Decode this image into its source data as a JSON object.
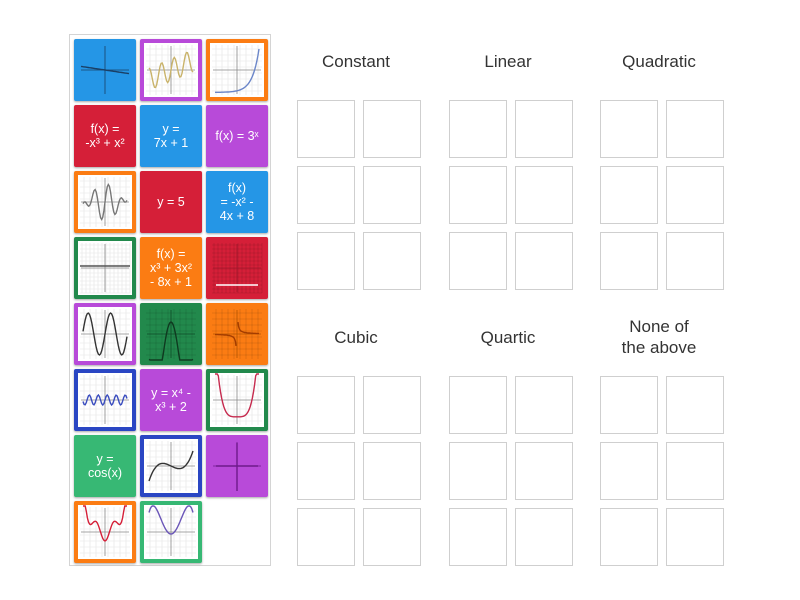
{
  "colors": {
    "blue": "#2596e6",
    "purple": "#b84ad9",
    "orange": "#fb7c13",
    "red": "#d51f38",
    "green": "#22894c",
    "mint": "#37b874",
    "navy": "#2a46c3"
  },
  "cards": [
    {
      "type": "image",
      "color": "blue",
      "icon": "nearly-flat-line-graph-icon"
    },
    {
      "type": "image",
      "color": "purple",
      "icon": "wavy-curve-graph-icon"
    },
    {
      "type": "image",
      "color": "orange",
      "icon": "exponential-curve-graph-icon"
    },
    {
      "type": "text",
      "color": "red",
      "lines": [
        "f(x) =",
        "-x³ + x²"
      ]
    },
    {
      "type": "text",
      "color": "blue",
      "lines": [
        "y =",
        "7x + 1"
      ]
    },
    {
      "type": "text",
      "color": "purple",
      "lines": [
        "f(x) = 3ˣ"
      ]
    },
    {
      "type": "image",
      "color": "orange",
      "icon": "oscillating-wave-graph-icon"
    },
    {
      "type": "text",
      "color": "red",
      "lines": [
        "y = 5"
      ]
    },
    {
      "type": "text",
      "color": "blue",
      "lines": [
        "f(x)",
        "= -x² -",
        "4x + 8"
      ]
    },
    {
      "type": "image",
      "color": "green",
      "icon": "horizontal-line-graph-icon"
    },
    {
      "type": "text",
      "color": "orange",
      "lines": [
        "f(x) =",
        "x³ + 3x²",
        "- 8x + 1"
      ]
    },
    {
      "type": "image",
      "color": "red",
      "icon": "constant-line-graph-icon"
    },
    {
      "type": "image",
      "color": "purple",
      "icon": "sine-like-graph-icon"
    },
    {
      "type": "image",
      "color": "green",
      "icon": "quartic-w-graph-icon"
    },
    {
      "type": "image",
      "color": "orange",
      "icon": "hyperbola-graph-icon"
    },
    {
      "type": "image",
      "color": "navy",
      "icon": "small-wave-graph-icon"
    },
    {
      "type": "text",
      "color": "purple",
      "lines": [
        "y = x⁴ -",
        "x³ + 2"
      ]
    },
    {
      "type": "image",
      "color": "green",
      "icon": "u-curve-graph-icon"
    },
    {
      "type": "text",
      "color": "mint",
      "lines": [
        "y =",
        "cos(x)"
      ]
    },
    {
      "type": "image",
      "color": "navy",
      "icon": "cubic-s-curve-graph-icon"
    },
    {
      "type": "image",
      "color": "purple",
      "icon": "vertical-line-graph-icon"
    },
    {
      "type": "image",
      "color": "orange",
      "icon": "quartic-red-graph-icon"
    },
    {
      "type": "image",
      "color": "mint",
      "icon": "quartic-m-graph-icon"
    }
  ],
  "groups": [
    {
      "lines": [
        "Constant"
      ]
    },
    {
      "lines": [
        "Linear"
      ]
    },
    {
      "lines": [
        "Quadratic"
      ]
    },
    {
      "lines": [
        "Cubic"
      ]
    },
    {
      "lines": [
        "Quartic"
      ]
    },
    {
      "lines": [
        "None of",
        "the above"
      ]
    }
  ]
}
